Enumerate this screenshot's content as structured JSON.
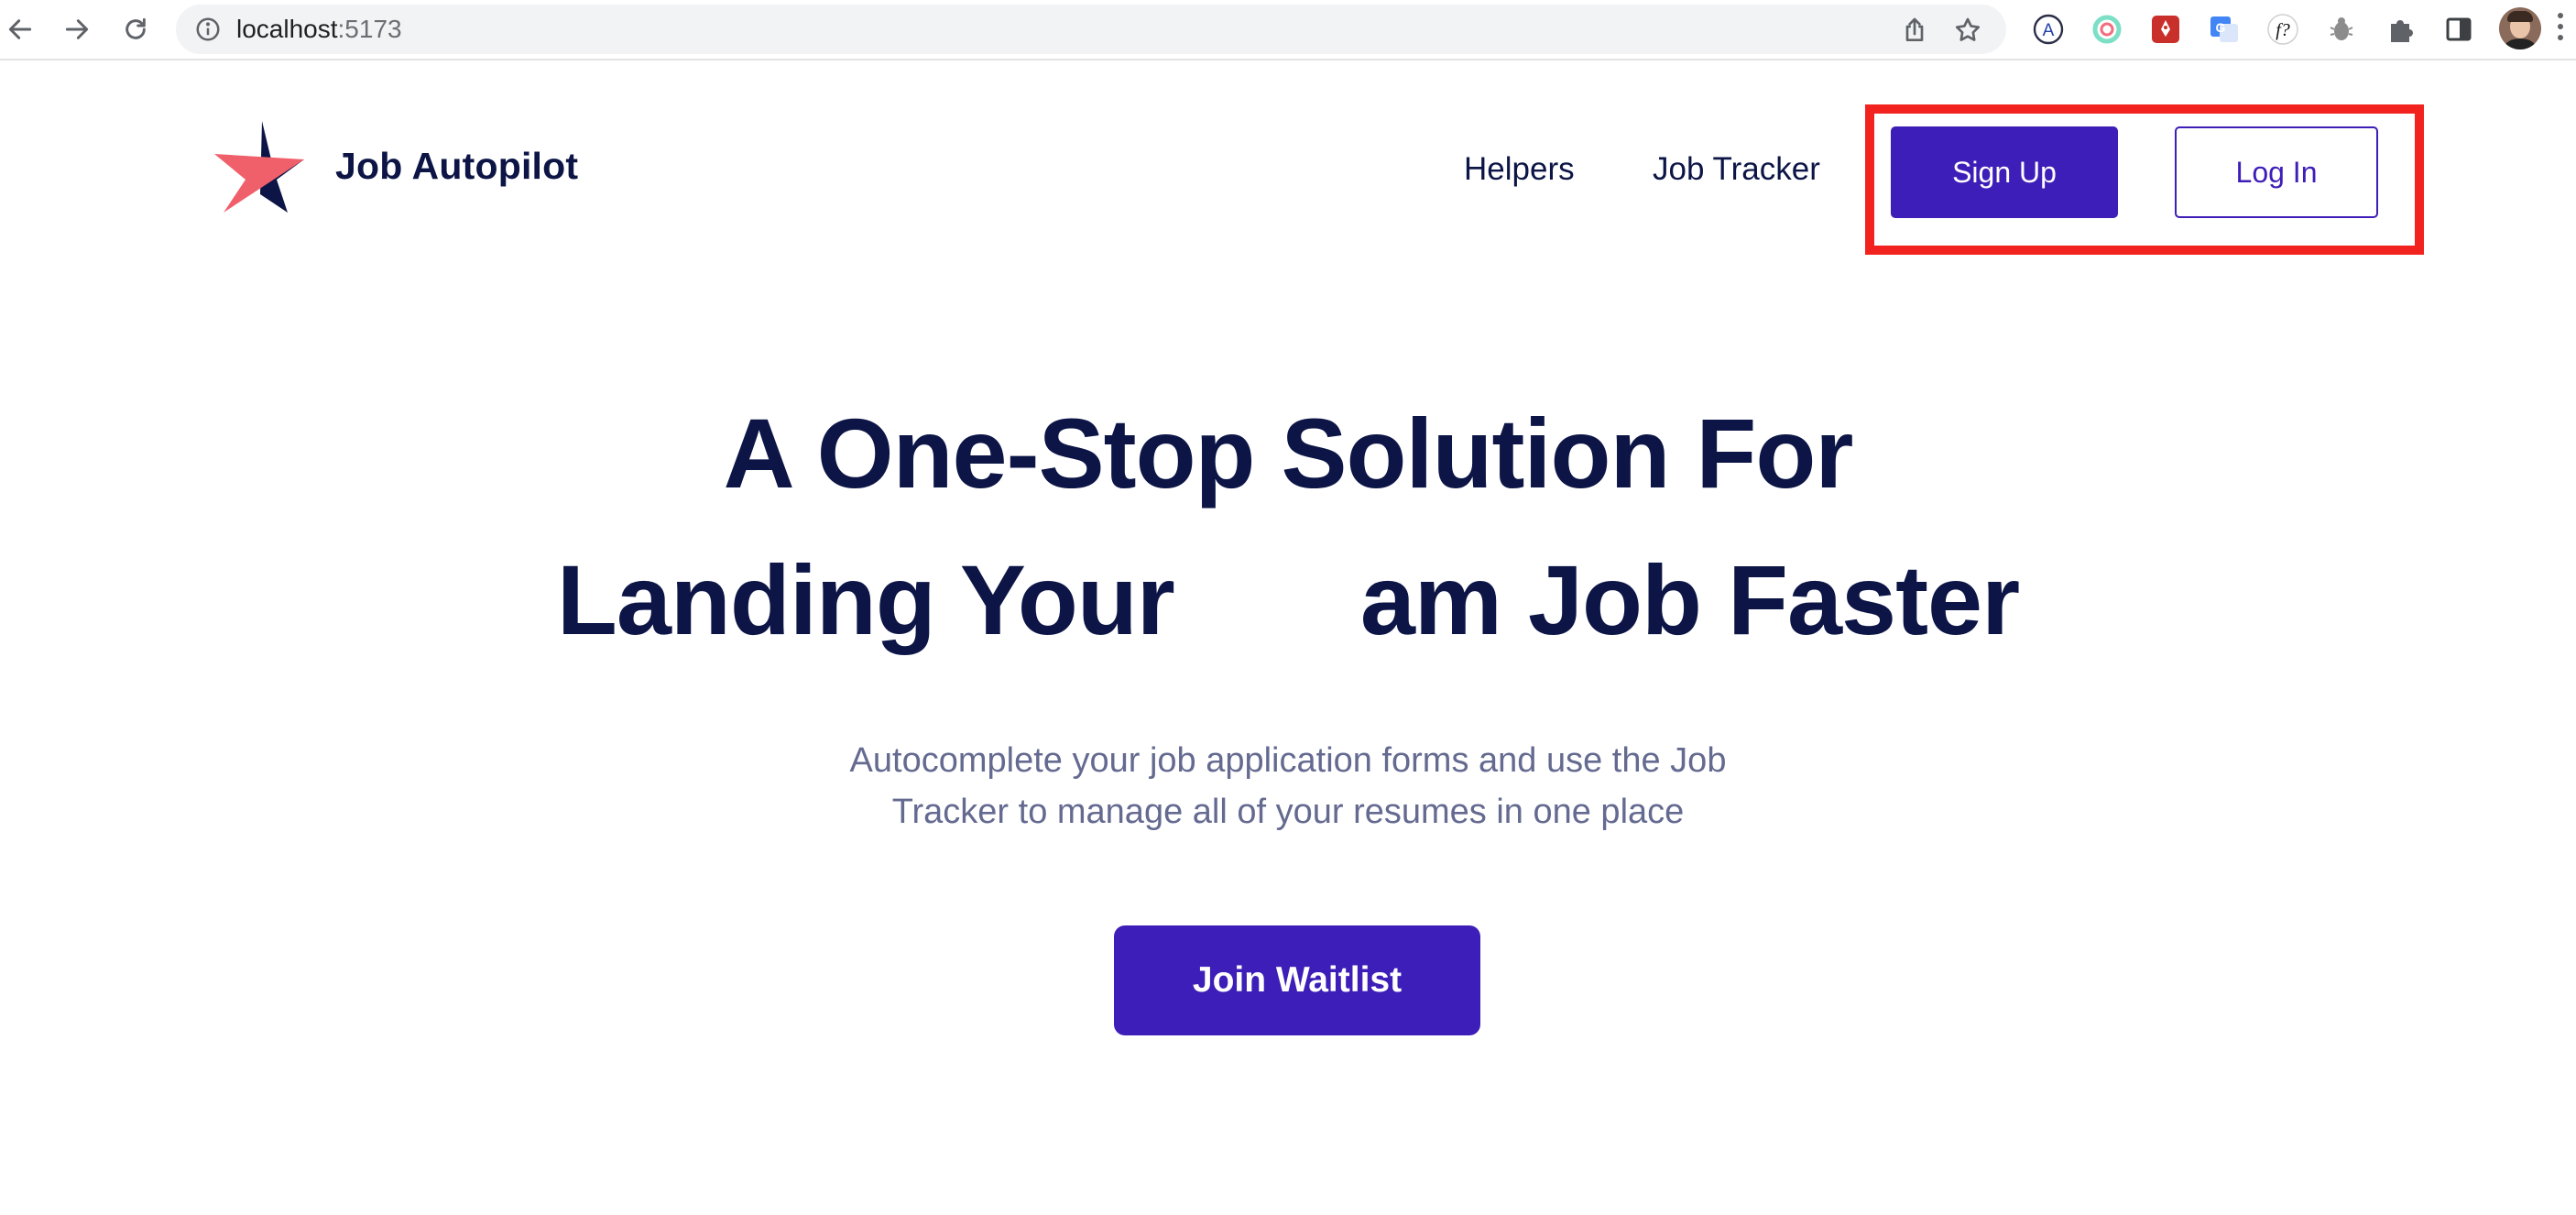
{
  "browser": {
    "url_host": "localhost",
    "url_port": ":5173",
    "extensions": [
      "translate-a-icon",
      "spinner-icon",
      "rocket-ext-icon",
      "google-translate-icon",
      "font-inspect-icon",
      "bug-icon",
      "puzzle-icon",
      "sidepanel-icon"
    ]
  },
  "header": {
    "brand": "Job Autopilot",
    "nav": [
      "Helpers",
      "Job Tracker"
    ],
    "signup_label": "Sign Up",
    "login_label": "Log In"
  },
  "hero": {
    "title_line1": "A One-Stop Solution For",
    "title_line2": "Landing Your       am Job Faster",
    "subtitle_line1": "Autocomplete your job application forms and use the Job",
    "subtitle_line2": "Tracker to manage all of your resumes in one place",
    "cta_label": "Join Waitlist"
  },
  "colors": {
    "primary": "#3e1eb8",
    "navy": "#0c1546",
    "muted": "#646a90",
    "logo_coral": "#f0606b",
    "highlight": "#f2231f"
  }
}
